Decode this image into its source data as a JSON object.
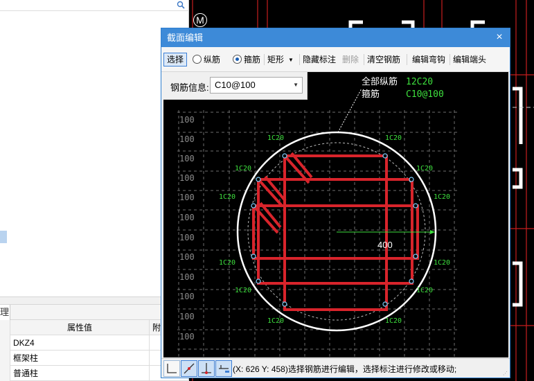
{
  "left_panel": {
    "tab_label": "理",
    "table": {
      "headers": [
        "",
        "属性值",
        "附"
      ],
      "rows": [
        {
          "value": "DKZ4"
        },
        {
          "value": "框架柱"
        },
        {
          "value": "普通柱"
        }
      ]
    }
  },
  "canvas_marker": "M",
  "dialog": {
    "title": "截面编辑",
    "close": "×",
    "toolbar": {
      "select": "选择",
      "longitudinal": "纵筋",
      "stirrup": "箍筋",
      "shape": "矩形",
      "hide_label": "隐藏标注",
      "delete": "删除",
      "clear_rebar": "清空钢筋",
      "edit_hook": "编辑弯钩",
      "edit_end": "编辑端头"
    },
    "rebar_info": {
      "label": "钢筋信息:",
      "value": "C10@100"
    },
    "drawing": {
      "all_long_label": "全部纵筋",
      "all_long_value": "12C20",
      "stirrup_label": "箍筋",
      "stirrup_value": "C10@100",
      "grid_label": "100",
      "bar_label": "1C20",
      "dimension": "400",
      "colors": {
        "stirrup": "#d8242b",
        "text_green": "#3ee03e",
        "circle": "#ffffff",
        "grid": "#6e6e6e"
      }
    },
    "status": {
      "text": "(X: 626 Y: 458)选择钢筋进行编辑，选择标注进行修改或移动;"
    }
  }
}
